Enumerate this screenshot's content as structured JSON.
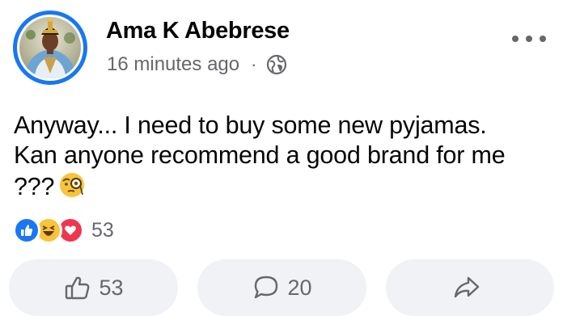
{
  "post": {
    "author": "Ama K Abebrese",
    "timestamp": "16 minutes ago",
    "separator": "·",
    "privacy_icon": "globe-icon",
    "text_lines": [
      "Anyway... I need to buy some new pyjamas.",
      "Kan anyone recommend a good brand for me",
      "???"
    ],
    "emoji": "face-with-monocle"
  },
  "reactions": {
    "types": [
      "like",
      "haha",
      "love"
    ],
    "count": "53"
  },
  "actions": {
    "like_count": "53",
    "comment_count": "20",
    "share_icon": "share-icon"
  },
  "colors": {
    "accent": "#1877f2",
    "secondary_text": "#65676b",
    "button_bg": "#f0f2f5",
    "love": "#f0364f",
    "haha": "#f7c43a"
  }
}
